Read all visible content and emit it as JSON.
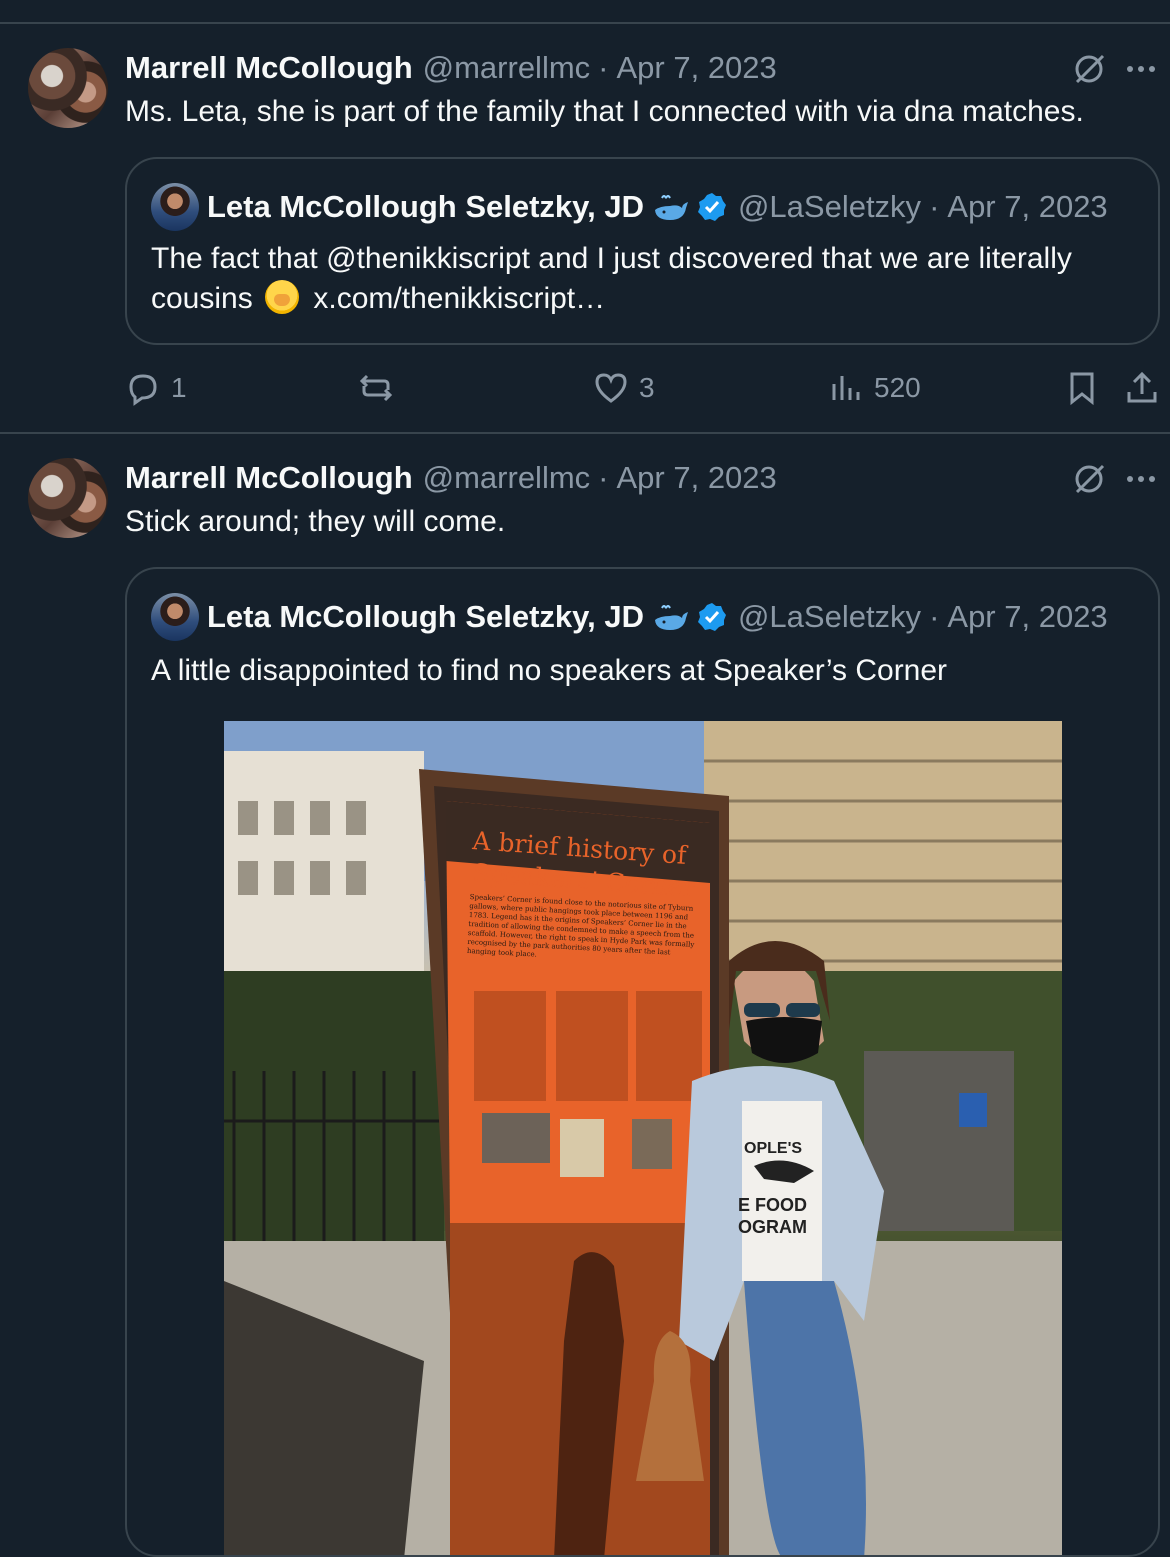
{
  "thread": [
    {
      "author": {
        "name": "Marrell McCollough",
        "handle": "@marrellmc",
        "date": "Apr 7, 2023"
      },
      "text": "Ms. Leta, she is part of the family that I connected with via dna matches.",
      "quote": {
        "author": {
          "name": "Leta McCollough Seletzky, JD",
          "handle": "@LaSeletzky",
          "date": "Apr 7, 2023"
        },
        "line1": "The fact that @thenikkiscript and I just discovered that we are literally",
        "line2_prefix": "cousins",
        "line2_link": "x.com/thenikkiscript…"
      },
      "actions": {
        "replies": "1",
        "likes": "3",
        "views": "520"
      }
    },
    {
      "author": {
        "name": "Marrell McCollough",
        "handle": "@marrellmc",
        "date": "Apr 7, 2023"
      },
      "text": "Stick around; they will come.",
      "quote": {
        "author": {
          "name": "Leta McCollough Seletzky, JD",
          "handle": "@LaSeletzky",
          "date": "Apr 7, 2023"
        },
        "line1": "A little disappointed to find no speakers at Speaker’s Corner"
      },
      "photo": {
        "sign_title_1": "A brief history of",
        "sign_title_2": "Speakers’ Corner",
        "sign_intro": "Speakers’ Corner is found close to the notorious site of Tyburn gallows, where public hangings took place between 1196 and 1783. Legend has it the origins of Speakers’ Corner lie in the tradition of allowing the condemned to make a speech from the scaffold. However, the right to speak in Hyde Park was formally recognised by the park authorities 80 years after the last hanging took place.",
        "shirt_line1": "OPLE'S",
        "shirt_line2": "E FOOD",
        "shirt_line3": "OGRAM"
      }
    }
  ],
  "colors": {
    "background": "#15202b",
    "border": "#38444d",
    "muted": "#8b98a5",
    "verified": "#1d9bf0",
    "sign": "#e8632a"
  }
}
